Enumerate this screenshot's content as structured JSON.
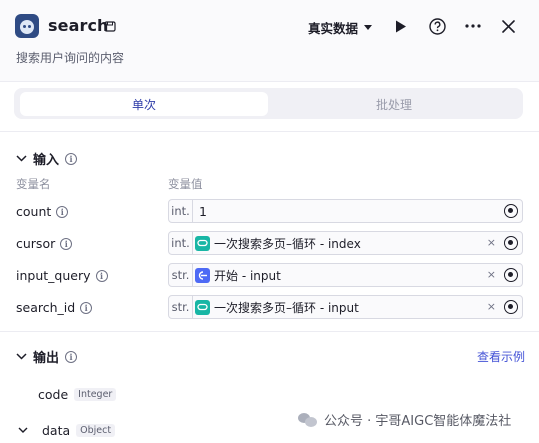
{
  "header": {
    "title": "search",
    "subtitle": "搜索用户询问的内容",
    "mode_label": "真实数据",
    "icons": [
      "robot-logo",
      "save-icon",
      "play-icon",
      "help-icon",
      "more-icon",
      "close-icon"
    ]
  },
  "tabs": [
    {
      "label": "单次",
      "active": true
    },
    {
      "label": "批处理",
      "active": false
    }
  ],
  "input_section": {
    "title": "输入",
    "col_name": "变量名",
    "col_value": "变量值",
    "rows": [
      {
        "name": "count",
        "type": "int.",
        "value": "1"
      },
      {
        "name": "cursor",
        "type": "int.",
        "ref": "一次搜索多页–循环 - index",
        "ref_icon": "loop-icon"
      },
      {
        "name": "input_query",
        "type": "str.",
        "ref": "开始 - input",
        "ref_icon": "start-icon"
      },
      {
        "name": "search_id",
        "type": "str.",
        "ref": "一次搜索多页–循环 - input",
        "ref_icon": "loop-icon"
      }
    ],
    "clear_symbol": "×"
  },
  "output_section": {
    "title": "输出",
    "example_link": "查看示例",
    "items": [
      {
        "name": "code",
        "type": "Integer"
      },
      {
        "name": "data",
        "type": "Object"
      }
    ]
  },
  "watermark": "公众号 · 宇哥AIGC智能体魔法社",
  "colors": {
    "accent": "#2e3ca8",
    "link": "#4453d6",
    "loop": "#18b6a5",
    "start": "#4e6af5"
  }
}
